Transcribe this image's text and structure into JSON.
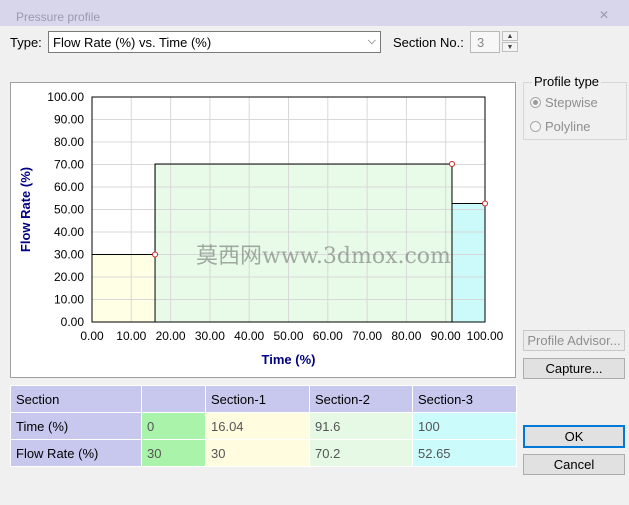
{
  "window": {
    "title": "Pressure profile"
  },
  "type_label": "Type:",
  "type_value": "Flow Rate (%) vs. Time (%)",
  "section_no_label": "Section No.:",
  "section_no_value": "3",
  "profile_type": {
    "title": "Profile type",
    "options": [
      "Stepwise",
      "Polyline"
    ],
    "selected": "Stepwise"
  },
  "buttons": {
    "advisor": "Profile Advisor...",
    "capture": "Capture...",
    "ok": "OK",
    "cancel": "Cancel"
  },
  "watermark": "莫西网www.3dmox.com",
  "colors": {
    "section0": "#ffffe6",
    "section1": "#e8fbe8",
    "section2": "#ccfafa",
    "plot_line": "#000000",
    "marker": "#cc2222",
    "axis_title": "#000080"
  },
  "chart_data": {
    "type": "area",
    "style": "stepwise",
    "xlabel": "Time (%)",
    "ylabel": "Flow Rate (%)",
    "xlim": [
      0,
      100
    ],
    "ylim": [
      0,
      100
    ],
    "x_ticks": [
      "0.00",
      "10.00",
      "20.00",
      "30.00",
      "40.00",
      "50.00",
      "60.00",
      "70.00",
      "80.00",
      "90.00",
      "100.00"
    ],
    "y_ticks": [
      "0.00",
      "10.00",
      "20.00",
      "30.00",
      "40.00",
      "50.00",
      "60.00",
      "70.00",
      "80.00",
      "90.00",
      "100.00"
    ],
    "grid": true,
    "points": [
      {
        "x": 0,
        "y": 30
      },
      {
        "x": 16.04,
        "y": 30
      },
      {
        "x": 91.6,
        "y": 70.2
      },
      {
        "x": 100,
        "y": 52.65
      }
    ]
  },
  "table": {
    "headers": [
      "Section",
      "",
      "Section-1",
      "Section-2",
      "Section-3"
    ],
    "rows": [
      {
        "label": "Time (%)",
        "values": [
          "0",
          "16.04",
          "91.6",
          "100"
        ]
      },
      {
        "label": "Flow Rate (%)",
        "values": [
          "30",
          "30",
          "70.2",
          "52.65"
        ]
      }
    ]
  }
}
